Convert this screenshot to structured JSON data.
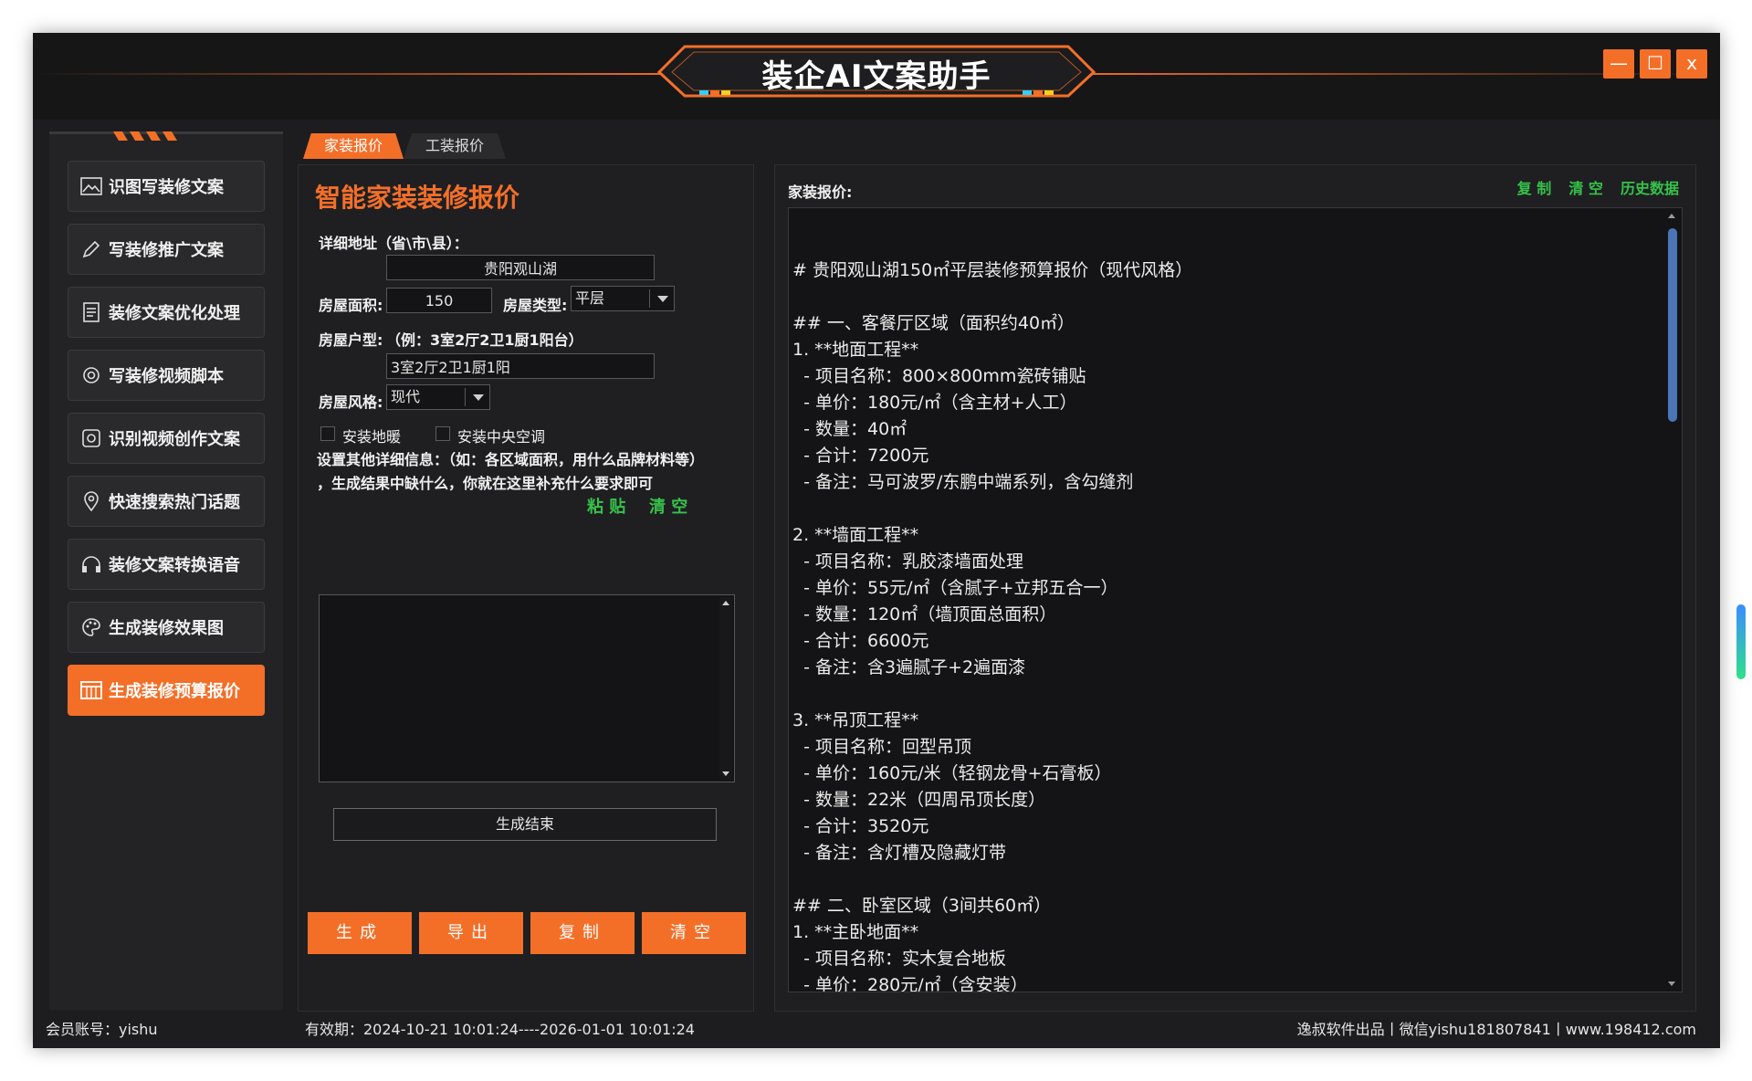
{
  "window": {
    "title": "装企AI文案助手",
    "controls": {
      "minimize": "—",
      "maximize": "☐",
      "close": "x"
    }
  },
  "sidebar": {
    "items": [
      {
        "label": "识图写装修文案",
        "icon": "image-icon"
      },
      {
        "label": "写装修推广文案",
        "icon": "pen-icon"
      },
      {
        "label": "装修文案优化处理",
        "icon": "document-icon"
      },
      {
        "label": "写装修视频脚本",
        "icon": "camera-icon"
      },
      {
        "label": "识别视频创作文案",
        "icon": "settings-icon"
      },
      {
        "label": "快速搜索热门话题",
        "icon": "location-icon"
      },
      {
        "label": "装修文案转换语音",
        "icon": "headphones-icon"
      },
      {
        "label": "生成装修效果图",
        "icon": "palette-icon"
      },
      {
        "label": "生成装修预算报价",
        "icon": "calculator-icon",
        "active": true
      }
    ]
  },
  "tabs": [
    {
      "label": "家装报价",
      "active": true
    },
    {
      "label": "工装报价",
      "active": false
    }
  ],
  "form": {
    "title": "智能家装装修报价",
    "address_label": "详细地址（省\\市\\县）：",
    "address_value": "贵阳观山湖",
    "area_label": "房屋面积:",
    "area_value": "150",
    "type_label": "房屋类型:",
    "type_value": "平层",
    "layout_label": "房屋户型:",
    "layout_example": "（例：3室2厅2卫1厨1阳台）",
    "layout_value": "3室2厅2卫1厨1阳",
    "style_label": "房屋风格:",
    "style_value": "现代",
    "checkbox_floor_heating": "安装地暖",
    "checkbox_central_ac": "安装中央空调",
    "details_note_1": "设置其他详细信息：（如：各区域面积，用什么品牌材料等）",
    "details_note_2": "，生成结果中缺什么，你就在这里补充什么要求即可",
    "paste": "粘 贴",
    "clear_small": "清 空",
    "details_value": "",
    "status": "生成结束",
    "buttons": {
      "generate": "生成",
      "export": "导出",
      "copy": "复制",
      "clear": "清空"
    }
  },
  "output": {
    "label": "家装报价:",
    "links": {
      "copy": "复 制",
      "clear": "清 空",
      "history": "历史数据"
    },
    "lines": [
      "# 贵阳观山湖150㎡平层装修预算报价（现代风格）",
      "",
      "## 一、客餐厅区域（面积约40㎡）",
      "1. **地面工程**",
      "  - 项目名称：800×800mm瓷砖铺贴",
      "  - 单价：180元/㎡（含主材+人工）",
      "  - 数量：40㎡",
      "  - 合计：7200元",
      "  - 备注：马可波罗/东鹏中端系列，含勾缝剂",
      "",
      "2. **墙面工程**",
      "  - 项目名称：乳胶漆墙面处理",
      "  - 单价：55元/㎡（含腻子+立邦五合一）",
      "  - 数量：120㎡（墙顶面总面积）",
      "  - 合计：6600元",
      "  - 备注：含3遍腻子+2遍面漆",
      "",
      "3. **吊顶工程**",
      "  - 项目名称：回型吊顶",
      "  - 单价：160元/米（轻钢龙骨+石膏板）",
      "  - 数量：22米（四周吊顶长度）",
      "  - 合计：3520元",
      "  - 备注：含灯槽及隐藏灯带",
      "",
      "## 二、卧室区域（3间共60㎡）",
      "1. **主卧地面**",
      "  - 项目名称：实木复合地板",
      "  - 单价：280元/㎡（含安装）"
    ]
  },
  "statusbar": {
    "account": "会员账号：yishu",
    "validity": "有效期：2024-10-21 10:01:24----2026-01-01 10:01:24",
    "credits": "逸叔软件出品丨微信yishu181807841丨www.198412.com"
  },
  "colors": {
    "accent": "#f36f28",
    "link_green": "#36c24a",
    "background": "#1d1d1f"
  }
}
